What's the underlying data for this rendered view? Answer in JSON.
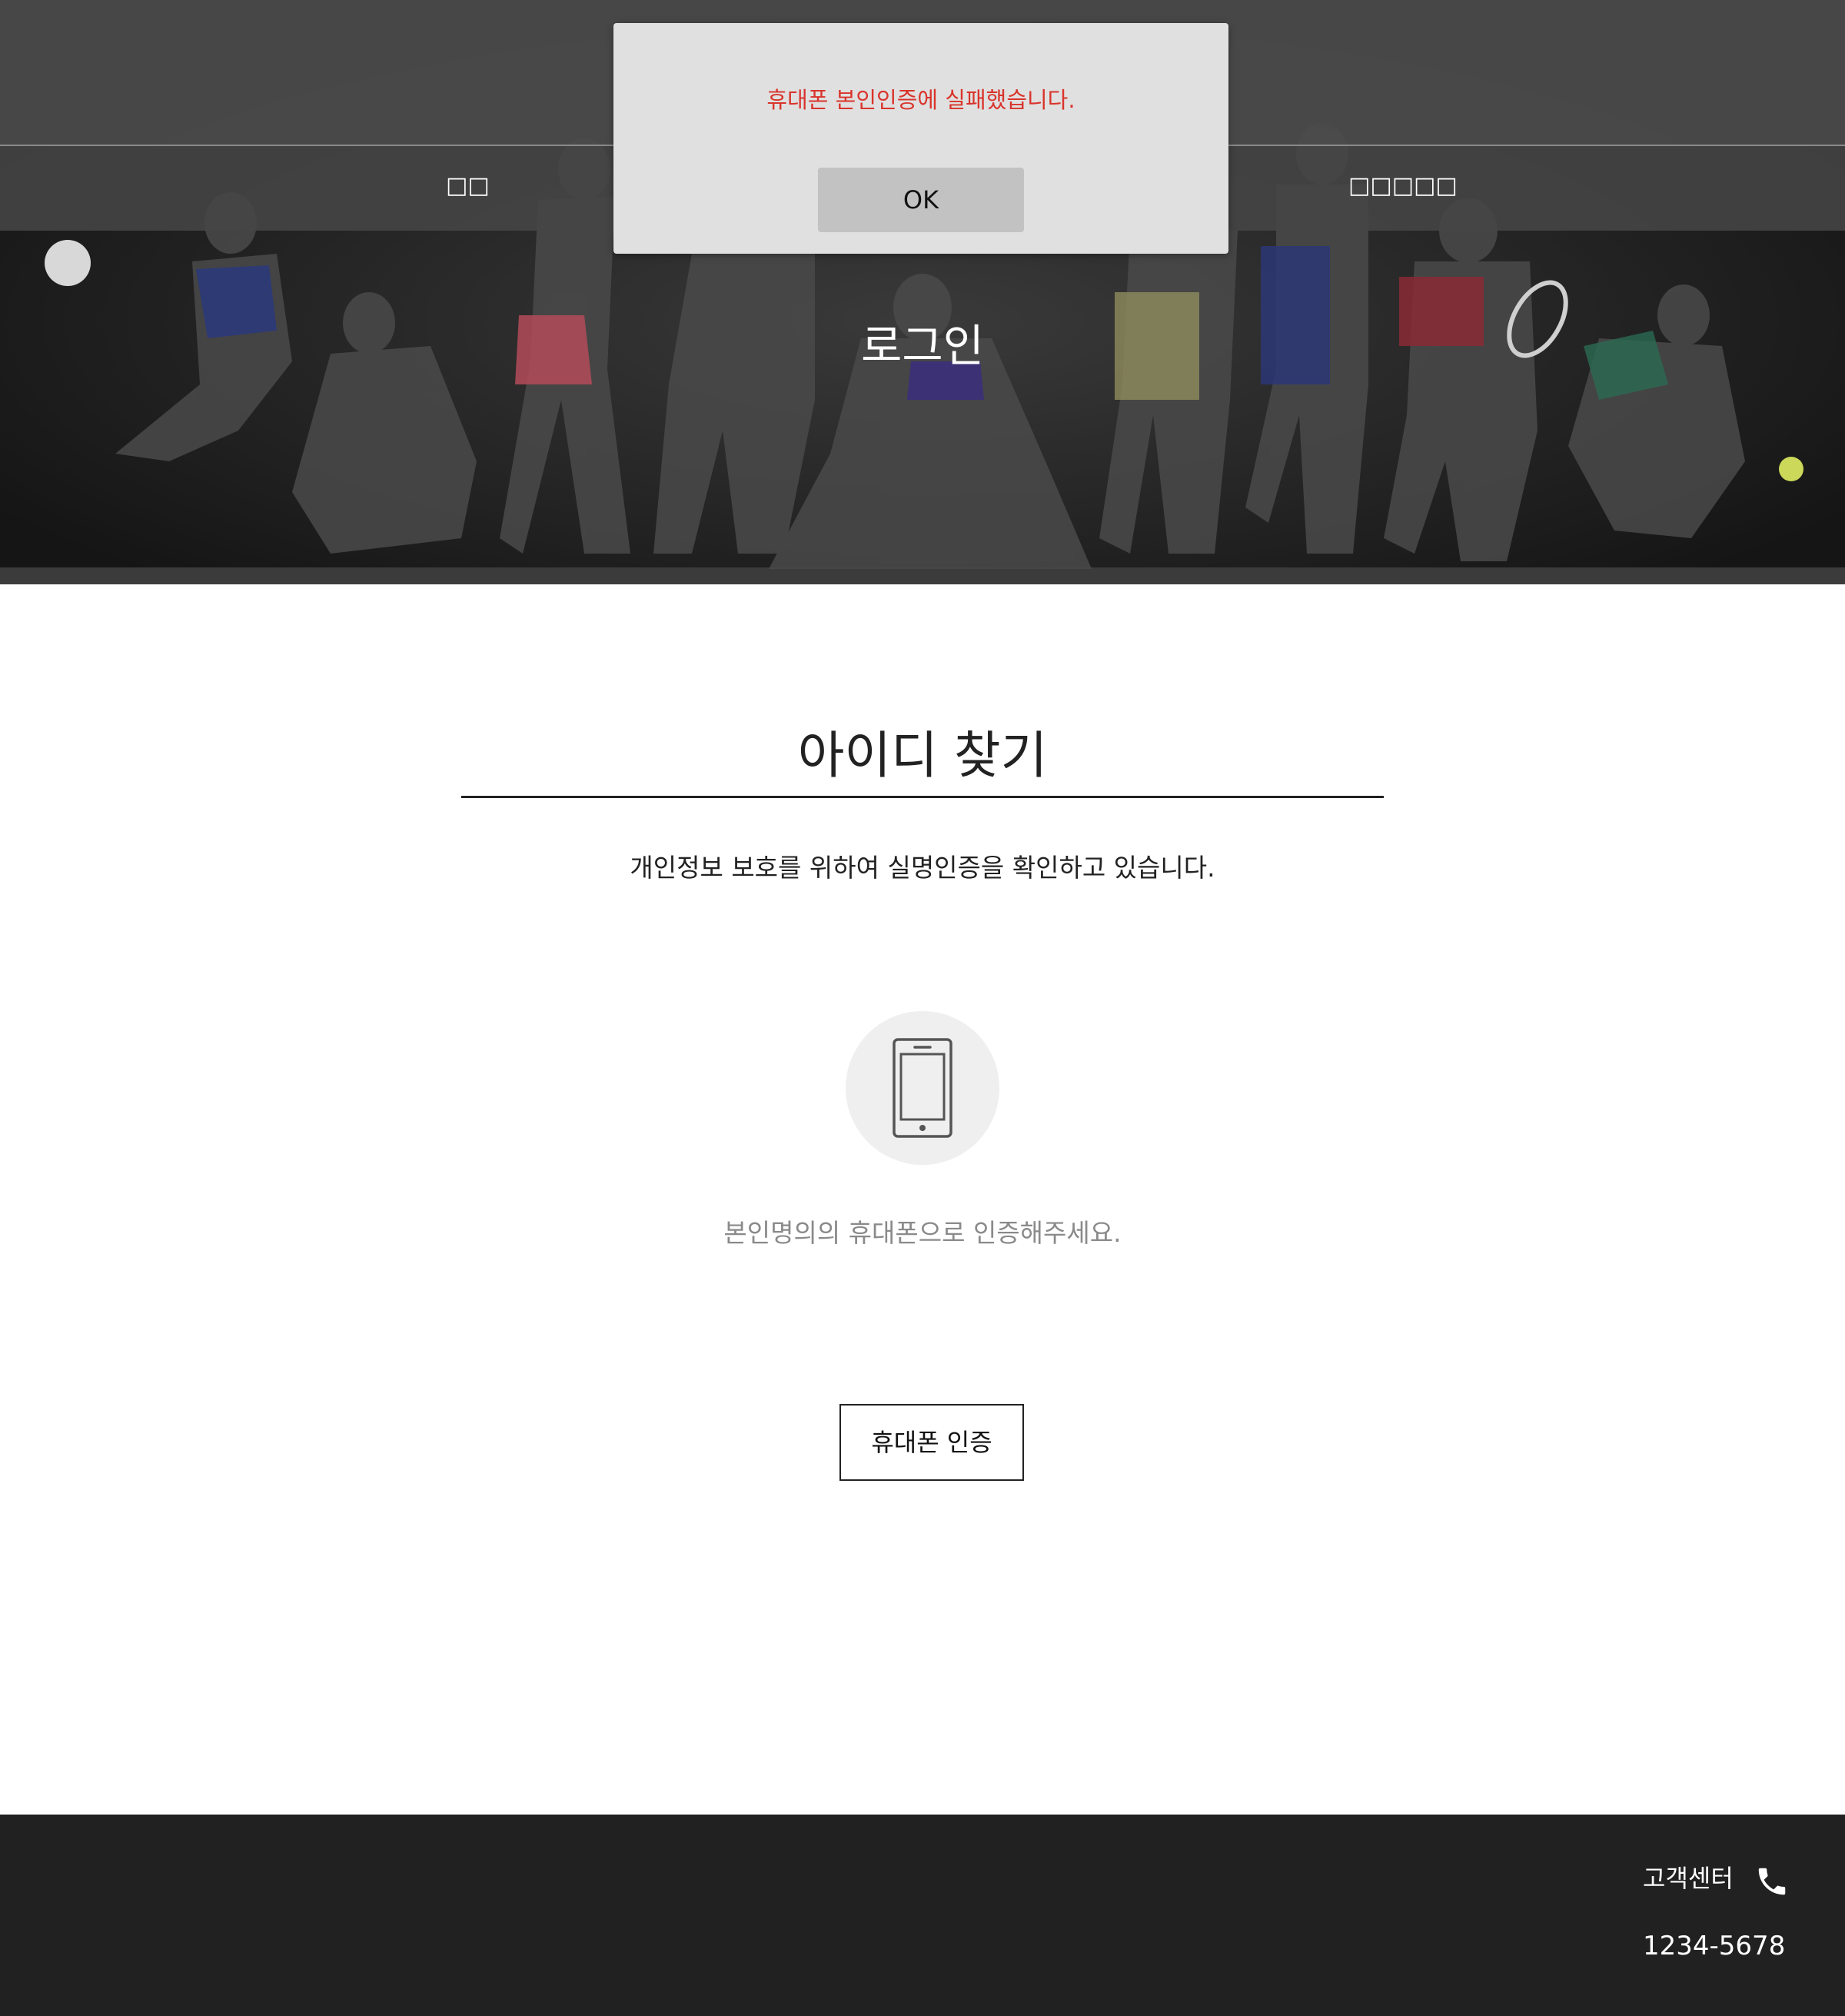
{
  "nav": {
    "item_left": "□□",
    "item_right": "□□□□□"
  },
  "hero": {
    "title": "로그인"
  },
  "alert": {
    "message": "휴대폰 본인인증에 실패했습니다.",
    "ok_label": "OK",
    "message_color": "#d9342b"
  },
  "main": {
    "title": "아이디 찾기",
    "subtitle": "개인정보 보호를 위하여 실명인증을 확인하고 있습니다.",
    "method_icon": "smartphone-icon",
    "hint": "본인명의의 휴대폰으로 인증해주세요.",
    "verify_button": "휴대폰 인증"
  },
  "footer": {
    "cs_label": "고객센터",
    "cs_icon": "phone-icon",
    "cs_number": "1234-5678"
  }
}
